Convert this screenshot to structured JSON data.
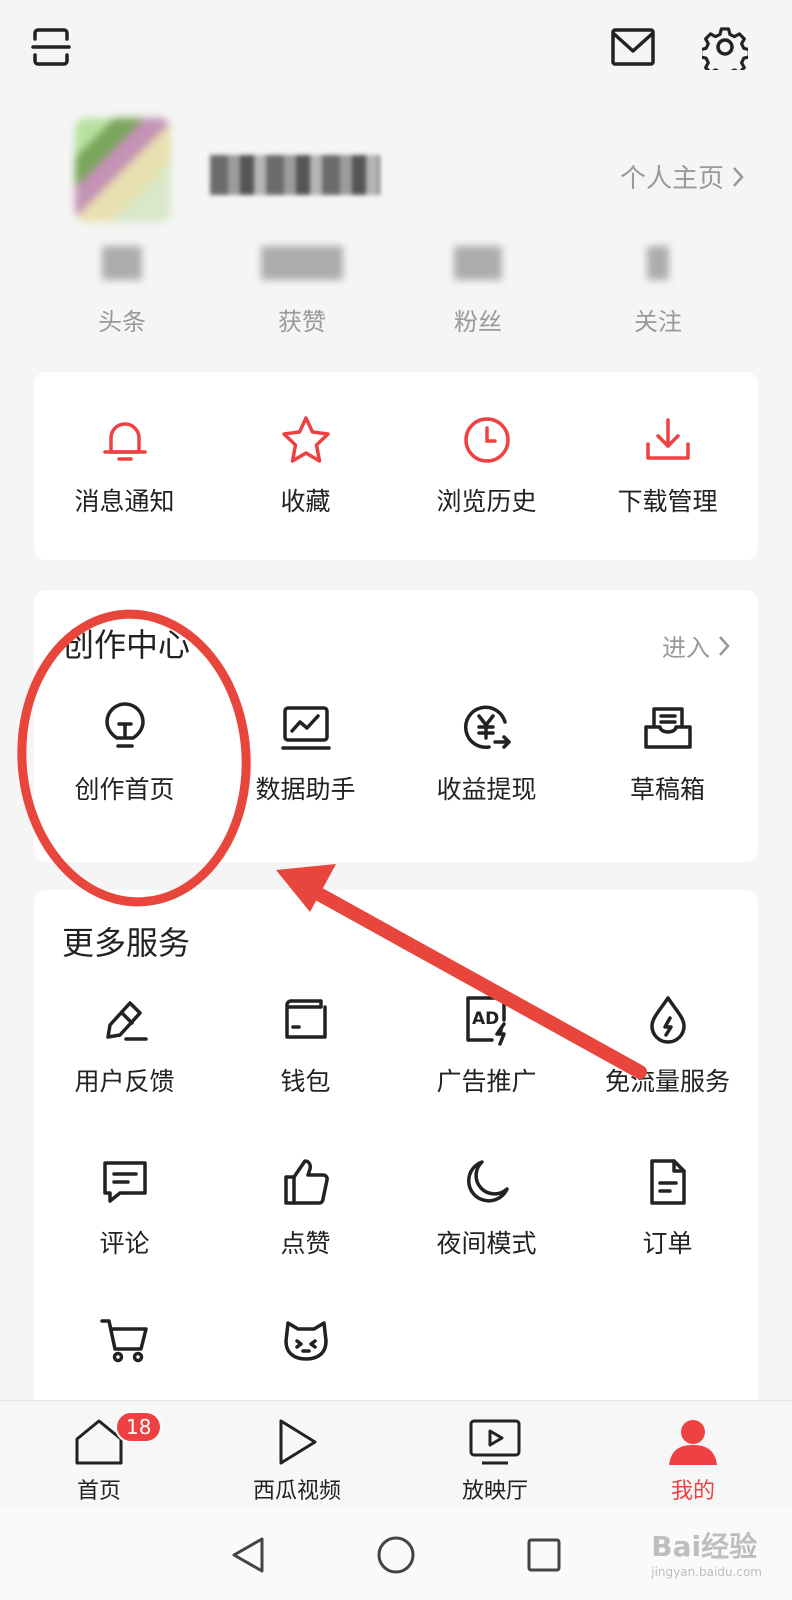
{
  "profile": {
    "homepage_link": "个人主页",
    "stats": [
      {
        "label": "头条"
      },
      {
        "label": "获赞"
      },
      {
        "label": "粉丝"
      },
      {
        "label": "关注"
      }
    ]
  },
  "quick": [
    {
      "label": "消息通知",
      "icon": "bell-icon"
    },
    {
      "label": "收藏",
      "icon": "star-icon"
    },
    {
      "label": "浏览历史",
      "icon": "clock-icon"
    },
    {
      "label": "下载管理",
      "icon": "download-icon"
    }
  ],
  "creation": {
    "title": "创作中心",
    "enter": "进入",
    "items": [
      {
        "label": "创作首页",
        "icon": "lightbulb-icon"
      },
      {
        "label": "数据助手",
        "icon": "chart-monitor-icon"
      },
      {
        "label": "收益提现",
        "icon": "yuan-withdraw-icon"
      },
      {
        "label": "草稿箱",
        "icon": "draft-box-icon"
      }
    ]
  },
  "services": {
    "title": "更多服务",
    "items": [
      {
        "label": "用户反馈",
        "icon": "pen-icon"
      },
      {
        "label": "钱包",
        "icon": "wallet-icon"
      },
      {
        "label": "广告推广",
        "icon": "ad-icon"
      },
      {
        "label": "免流量服务",
        "icon": "data-drop-icon"
      },
      {
        "label": "评论",
        "icon": "comment-icon"
      },
      {
        "label": "点赞",
        "icon": "thumbs-up-icon"
      },
      {
        "label": "夜间模式",
        "icon": "moon-icon"
      },
      {
        "label": "订单",
        "icon": "order-doc-icon"
      },
      {
        "icon": "cart-icon"
      },
      {
        "icon": "cat-face-icon"
      }
    ]
  },
  "tabbar": {
    "items": [
      {
        "label": "首页",
        "badge": "18"
      },
      {
        "label": "西瓜视频"
      },
      {
        "label": "放映厅"
      },
      {
        "label": "我的"
      }
    ]
  },
  "watermark": {
    "brand": "Bai经验",
    "url": "jingyan.baidu.com"
  },
  "colors": {
    "accent": "#f04142",
    "annotation": "#e8453c"
  }
}
